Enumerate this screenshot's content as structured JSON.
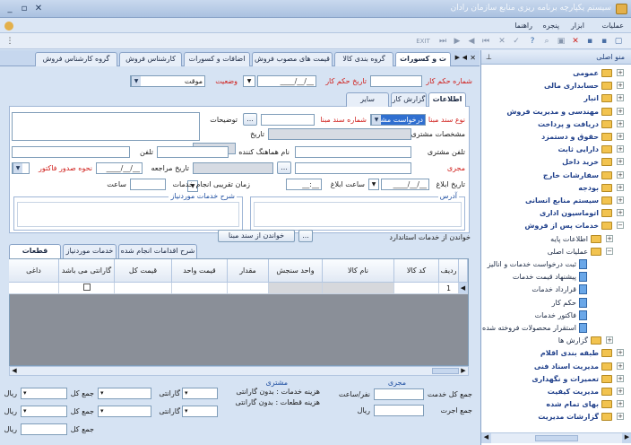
{
  "window": {
    "title": "سیستم یکپارچه برنامه ریزی منابع سازمان رادان"
  },
  "menubar": {
    "items": [
      "عملیات",
      "ابزار",
      "پنجره",
      "راهنما"
    ]
  },
  "sidebar": {
    "title": "منو اصلی",
    "items": [
      {
        "label": "عمومی",
        "level": 0
      },
      {
        "label": "حسابداری مالی",
        "level": 0
      },
      {
        "label": "انبار",
        "level": 0
      },
      {
        "label": "مهندسی و مدیریت فروش",
        "level": 0
      },
      {
        "label": "دریافت و پرداخت",
        "level": 0
      },
      {
        "label": "حقوق و دستمزد",
        "level": 0
      },
      {
        "label": "دارایی ثابت",
        "level": 0
      },
      {
        "label": "خرید داخل",
        "level": 0
      },
      {
        "label": "سفارشات خارج",
        "level": 0
      },
      {
        "label": "بودجه",
        "level": 0
      },
      {
        "label": "سیستم منابع انسانی",
        "level": 0
      },
      {
        "label": "اتوماسیون اداری",
        "level": 0
      },
      {
        "label": "خدمات پس از فروش",
        "level": 0
      },
      {
        "label": "اطلاعات پایه",
        "level": 1
      },
      {
        "label": "عملیات اصلی",
        "level": 1
      },
      {
        "label": "ثبت درخواست خدمات و انالیز",
        "level": 2
      },
      {
        "label": "پیشنهاد قیمت خدمات",
        "level": 2
      },
      {
        "label": "قرارداد خدمات",
        "level": 2
      },
      {
        "label": "حکم کار",
        "level": 2
      },
      {
        "label": "فاکتور خدمات",
        "level": 2
      },
      {
        "label": "استقرار محصولات فروخته شده",
        "level": 2
      },
      {
        "label": "گزارش ها",
        "level": 1
      },
      {
        "label": "طبقه بندی اقلام",
        "level": 0
      },
      {
        "label": "مدیریت اسناد فنی",
        "level": 0
      },
      {
        "label": "تعمیرات و نگهداری",
        "level": 0
      },
      {
        "label": "مدیریت کیفیت",
        "level": 0
      },
      {
        "label": "بهای تمام شده",
        "level": 0
      },
      {
        "label": "گزارشات مدیریت",
        "level": 0
      }
    ]
  },
  "tabs": [
    "ت و کسورات",
    "گروه بندی کالا",
    "قیمت های مصوب فروش",
    "اضافات و کسورات",
    "کارشناس فروش",
    "گروه کارشناس فروش"
  ],
  "header": {
    "work_order_no_label": "شماره حکم کار",
    "work_order_date_label": "تاریخ حکم کار",
    "work_order_date": "__/__/____",
    "status_label": "وضعیت",
    "status_value": "موقت"
  },
  "subtabs": [
    "اطلاعات اصلی",
    "گزارش کار",
    "سایر اطلاعات"
  ],
  "form": {
    "source_doc_type_label": "نوع سند مبنا",
    "source_doc_type": "درخواست مشت",
    "source_doc_no_label": "شماره سند مبنا",
    "description_label": "توضیحات",
    "customer_specs_label": "مشخصات مشتری",
    "date_label": "تاریخ",
    "customer_phone_label": "تلفن مشتری",
    "coordinator_label": "نام هماهنگ کننده",
    "phone_label": "تلفن",
    "executor_label": "مجری",
    "reference_date_label": "تاریخ مراجعه",
    "reference_date": "__/__/____",
    "invoice_method_label": "نحوه صدور فاکتور",
    "announce_date_label": "تاریخ ابلاغ",
    "announce_date": "__/__/____",
    "announce_time_label": "ساعت ابلاغ",
    "announce_time": "__:__",
    "service_time_label": "زمان تقریبی انجام خدمات",
    "hour_label": "ساعت",
    "address_label": "آدرس",
    "needed_services_desc_label": "شرح خدمات موردنیاز"
  },
  "read_services": {
    "label": "خواندن از خدمات استاندارد",
    "button": "خواندن از سند مبنا"
  },
  "grid_tabs": [
    "قطعات موردنیاز",
    "خدمات موردنیاز",
    "شرح اقدامات انجام شده"
  ],
  "grid": {
    "columns": [
      "ردیف",
      "کد کالا",
      "نام کالا",
      "واحد سنجش",
      "مقدار",
      "قیمت واحد",
      "قیمت کل",
      "گارانتی می باشد",
      "داغی"
    ],
    "rows": [
      {
        "row": "1",
        "code": "",
        "name": "",
        "unit": "",
        "qty": "",
        "unit_price": "",
        "total": "",
        "warranty": "",
        "scrap": ""
      }
    ]
  },
  "totals": {
    "customer_label": "مشتری",
    "executor_label": "مجری",
    "services_cost_label": "هزینه خدمات : بدون گارانتی",
    "parts_cost_label": "هزینه قطعات : بدون گارانتی",
    "warranty_label": "گارانتی",
    "sum_label": "جمع کل",
    "rial": "ریال",
    "sum_services_label": "جمع کل خدمت",
    "sum_wage_label": "جمع اجرت",
    "person_hour_label": "نفر/ساعت",
    "sum_total_label": "جمع کل"
  }
}
